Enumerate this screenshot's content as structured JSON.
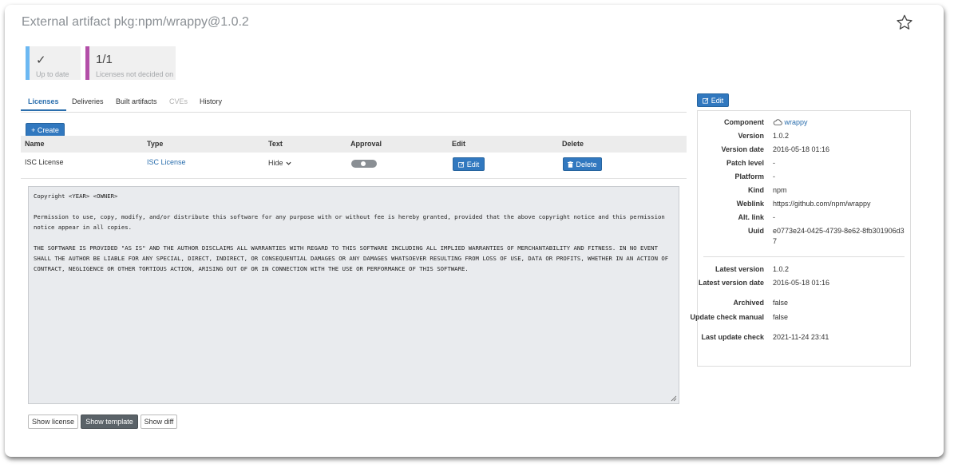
{
  "header": {
    "title": "External artifact pkg:npm/wrappy@1.0.2"
  },
  "stats": [
    {
      "value": "✓",
      "label": "Up to date",
      "color": "#6cb8f2"
    },
    {
      "value": "1/1",
      "label": "Licenses not decided on",
      "color": "#b34fa8"
    }
  ],
  "tabs": [
    {
      "label": "Licenses",
      "state": "active"
    },
    {
      "label": "Deliveries",
      "state": "normal"
    },
    {
      "label": "Built artifacts",
      "state": "normal"
    },
    {
      "label": "CVEs",
      "state": "disabled"
    },
    {
      "label": "History",
      "state": "normal"
    }
  ],
  "create_label": "+ Create",
  "table": {
    "headers": [
      "Name",
      "Type",
      "Text",
      "Approval",
      "Edit",
      "Delete"
    ],
    "rows": [
      {
        "name": "ISC License",
        "type": "ISC License",
        "text_toggle": "Hide",
        "approval": "undecided",
        "edit_label": "Edit",
        "delete_label": "Delete"
      }
    ]
  },
  "license_text": "Copyright <YEAR> <OWNER>\n\nPermission to use, copy, modify, and/or distribute this software for any purpose with or without fee is hereby granted, provided that the above copyright notice and this permission notice appear in all copies.\n\nTHE SOFTWARE IS PROVIDED \"AS IS\" AND THE AUTHOR DISCLAIMS ALL WARRANTIES WITH REGARD TO THIS SOFTWARE INCLUDING ALL IMPLIED WARRANTIES OF MERCHANTABILITY AND FITNESS. IN NO EVENT SHALL THE AUTHOR BE LIABLE FOR ANY SPECIAL, DIRECT, INDIRECT, OR CONSEQUENTIAL DAMAGES OR ANY DAMAGES WHATSOEVER RESULTING FROM LOSS OF USE, DATA OR PROFITS, WHETHER IN AN ACTION OF CONTRACT, NEGLIGENCE OR OTHER TORTIOUS ACTION, ARISING OUT OF OR IN CONNECTION WITH THE USE OR PERFORMANCE OF THIS SOFTWARE.",
  "view_buttons": {
    "show_license": "Show license",
    "show_template": "Show template",
    "show_diff": "Show diff",
    "active": "show_template"
  },
  "details": {
    "edit_label": "Edit",
    "component": {
      "label": "Component",
      "value": "wrappy",
      "icon": "cloud-icon"
    },
    "version": {
      "label": "Version",
      "value": "1.0.2"
    },
    "version_date": {
      "label": "Version date",
      "value": "2016-05-18 01:16"
    },
    "patch_level": {
      "label": "Patch level",
      "value": "-"
    },
    "platform": {
      "label": "Platform",
      "value": "-"
    },
    "kind": {
      "label": "Kind",
      "value": "npm"
    },
    "weblink": {
      "label": "Weblink",
      "value": "https://github.com/npm/wrappy"
    },
    "alt_link": {
      "label": "Alt. link",
      "value": "-"
    },
    "uuid": {
      "label": "Uuid",
      "value": "e0773e24-0425-4739-8e62-8fb301906d37"
    },
    "latest_version": {
      "label": "Latest version",
      "value": "1.0.2"
    },
    "latest_version_date": {
      "label": "Latest version date",
      "value": "2016-05-18 01:16"
    },
    "archived": {
      "label": "Archived",
      "value": "false"
    },
    "update_check_manual": {
      "label": "Update check manual",
      "value": "false"
    },
    "last_update_check": {
      "label": "Last update check",
      "value": "2021-11-24 23:41"
    }
  },
  "colors": {
    "primary": "#3178bf",
    "link": "#2a6ead",
    "muted": "#8a8f94"
  }
}
